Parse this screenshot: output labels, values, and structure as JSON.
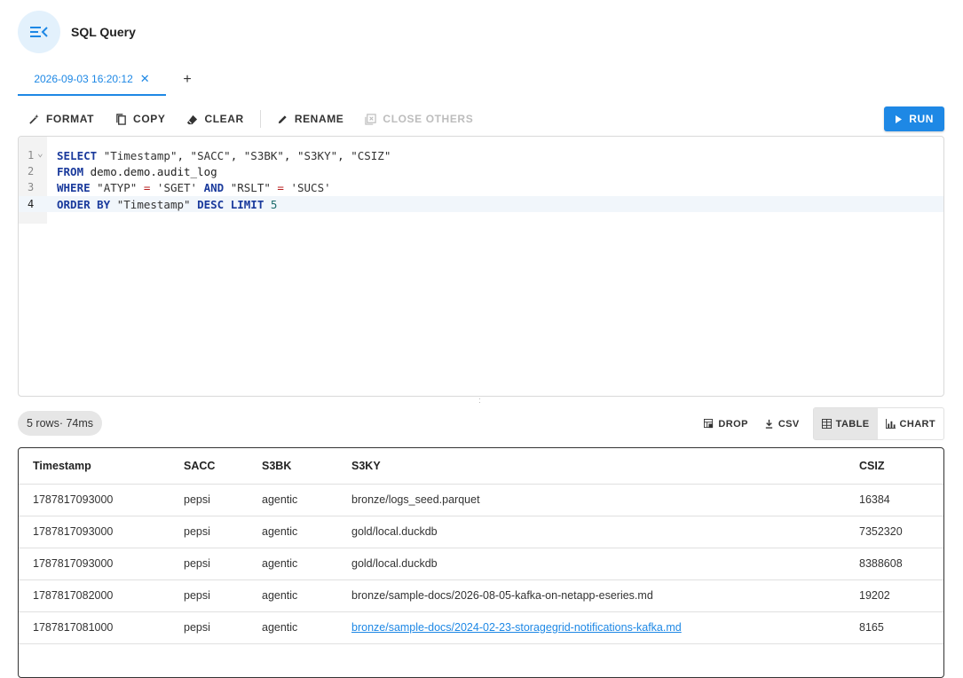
{
  "header": {
    "title": "SQL Query",
    "menu_icon": "menu-collapse-icon"
  },
  "tabs": [
    {
      "label": "2026-09-03 16:20:12",
      "active": true
    }
  ],
  "add_tab_label": "+",
  "toolbar": {
    "format_label": "FORMAT",
    "copy_label": "COPY",
    "clear_label": "CLEAR",
    "rename_label": "RENAME",
    "close_others_label": "CLOSE OTHERS",
    "run_label": "RUN"
  },
  "editor": {
    "lines": [
      {
        "num": "1"
      },
      {
        "num": "2"
      },
      {
        "num": "3"
      },
      {
        "num": "4"
      }
    ],
    "query": "SELECT \"Timestamp\", \"SACC\", \"S3BK\", \"S3KY\", \"CSIZ\"\nFROM demo.demo.audit_log\nWHERE \"ATYP\" = 'SGET' AND \"RSLT\" = 'SUCS'\nORDER BY \"Timestamp\" DESC LIMIT 5"
  },
  "results": {
    "status": "5 rows· 74ms",
    "tools": {
      "drop": "DROP",
      "csv": "CSV",
      "table": "TABLE",
      "chart": "CHART"
    },
    "columns": [
      "Timestamp",
      "SACC",
      "S3BK",
      "S3KY",
      "CSIZ"
    ],
    "rows": [
      [
        "1787817093000",
        "pepsi",
        "agentic",
        "bronze/logs_seed.parquet",
        "16384"
      ],
      [
        "1787817093000",
        "pepsi",
        "agentic",
        "gold/local.duckdb",
        "7352320"
      ],
      [
        "1787817093000",
        "pepsi",
        "agentic",
        "gold/local.duckdb",
        "8388608"
      ],
      [
        "1787817082000",
        "pepsi",
        "agentic",
        "bronze/sample-docs/2026-08-05-kafka-on-netapp-eseries.md",
        "19202"
      ],
      [
        "1787817081000",
        "pepsi",
        "agentic",
        "bronze/sample-docs/2024-02-23-storagegrid-notifications-kafka.md",
        "8165"
      ]
    ]
  },
  "colors": {
    "accent": "#1e88e5",
    "menu_bg": "#e3f1fc"
  }
}
